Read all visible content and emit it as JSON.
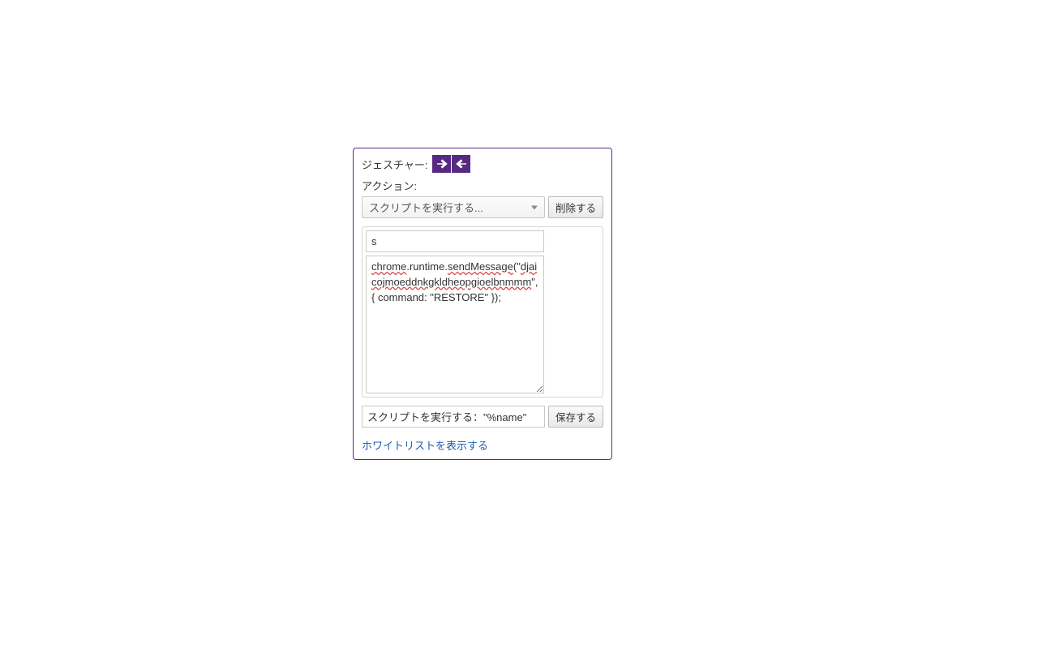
{
  "gesture": {
    "label": "ジェスチャー:",
    "icons": [
      "arrow-right-icon",
      "arrow-left-icon"
    ]
  },
  "action": {
    "label": "アクション:",
    "selected": "スクリプトを実行する...",
    "delete_button": "削除する"
  },
  "script": {
    "name_value": "s",
    "code_plain": "chrome.runtime.sendMessage(\"djaicojmoeddnkgkldheopgioelbnmmm\", { command: \"RESTORE\" });",
    "code_parts": {
      "p1": "chrome",
      "p2": ".runtime.",
      "p3": "sendMessage",
      "p4": "(\"",
      "p5": "djaicojmoeddnkgkldheopgioelbnmmm",
      "p6": "\", { command: \"RESTORE\" });"
    },
    "label_value": "スクリプトを実行する：\"%name\"",
    "save_button": "保存する"
  },
  "whitelist_link": "ホワイトリストを表示する",
  "colors": {
    "accent": "#572a82"
  }
}
